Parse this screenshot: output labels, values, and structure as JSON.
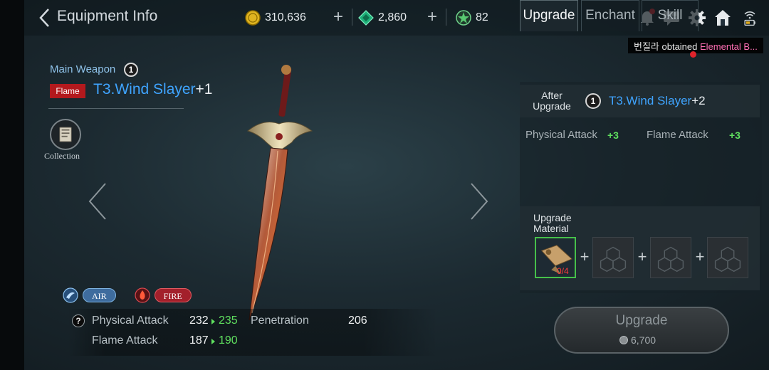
{
  "header": {
    "title": "Equipment Info",
    "gold": "310,636",
    "gems": "2,860",
    "energy": "82"
  },
  "notification": {
    "prefix": "번질라 obtained ",
    "highlight": "Elemental B..."
  },
  "item": {
    "slot": "Main Weapon",
    "tier": "1",
    "element": "Flame",
    "name": "T3.Wind Slayer",
    "level": "+1",
    "collection_label": "Collection"
  },
  "skills": {
    "air": "AIR",
    "fire": "FIRE"
  },
  "stats": {
    "help": "?",
    "physical_attack_label": "Physical Attack",
    "physical_attack_current": "232",
    "physical_attack_new": "235",
    "penetration_label": "Penetration",
    "penetration_value": "206",
    "flame_attack_label": "Flame Attack",
    "flame_attack_current": "187",
    "flame_attack_new": "190"
  },
  "tabs": [
    "Upgrade",
    "Enchant",
    "Skill"
  ],
  "upgrade_panel": {
    "after_label": "After Upgrade",
    "tier": "1",
    "after_name": "T3.Wind Slayer",
    "after_level": "+2",
    "gains": [
      {
        "label": "Physical Attack",
        "value": "+3"
      },
      {
        "label": "Flame Attack",
        "value": "+3"
      }
    ],
    "material_label": "Upgrade Material",
    "material_count": "0/4",
    "button_label": "Upgrade",
    "cost": "6,700"
  },
  "colors": {
    "accent_blue": "#3fa4ff",
    "stat_up_green": "#5fe05f",
    "flame_red": "#b3191d"
  },
  "icons": [
    "back-chevron-icon",
    "gold-coin-icon",
    "green-gem-icon",
    "energy-icon",
    "bell-icon",
    "chat-icon",
    "gear-icon",
    "home-icon",
    "wifi-battery-icon",
    "collection-book-icon",
    "air-element-icon",
    "fire-element-icon",
    "prev-arrow-icon",
    "next-arrow-icon",
    "drill-material-icon",
    "empty-slot-icon"
  ]
}
